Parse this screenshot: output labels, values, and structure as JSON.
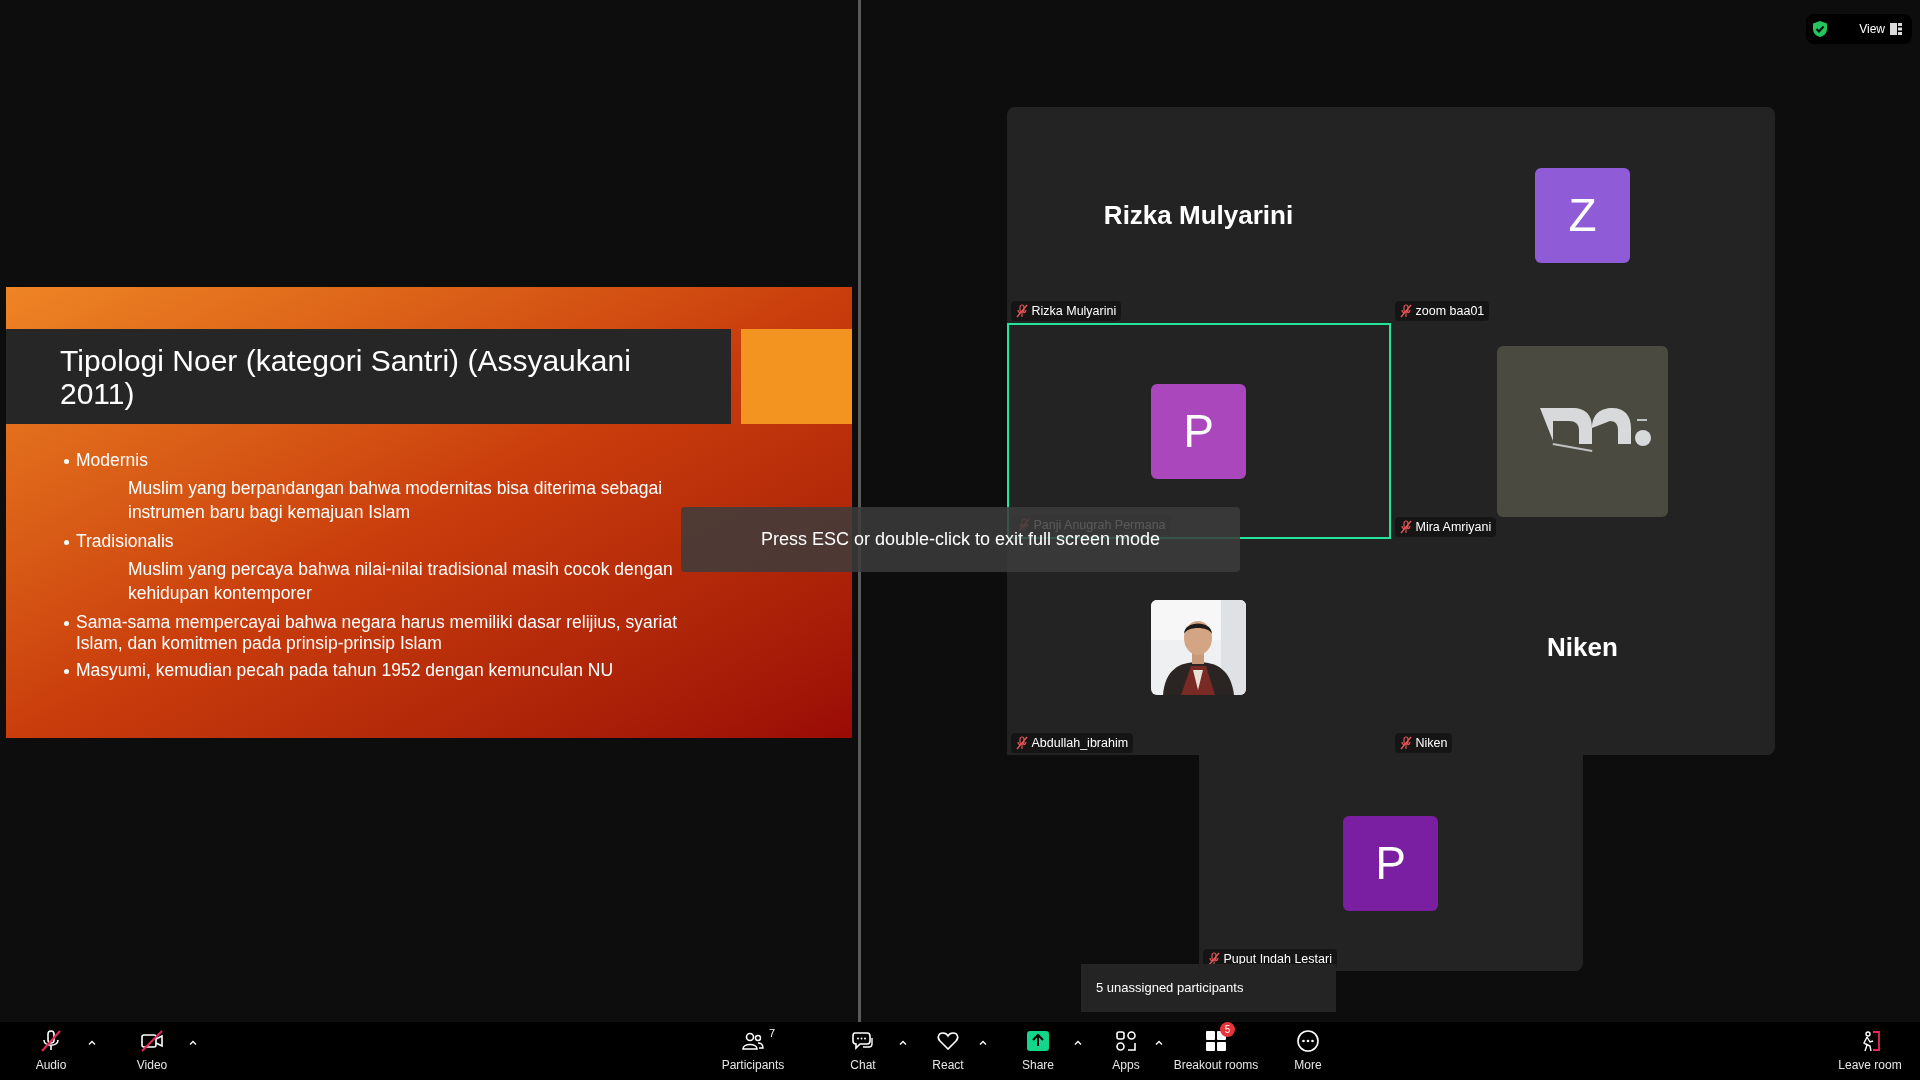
{
  "slide": {
    "title": "Tipologi Noer (kategori Santri) (Assyaukani 2011)",
    "bullets": [
      {
        "text": "Modernis",
        "children": [
          {
            "text": "Muslim yang berpandangan bahwa modernitas bisa diterima sebagai instrumen baru bagi kemajuan Islam"
          }
        ]
      },
      {
        "text": "Tradisionalis",
        "children": [
          {
            "text": "Muslim yang percaya bahwa nilai-nilai tradisional masih cocok dengan kehidupan kontemporer"
          }
        ]
      },
      {
        "text": "Sama-sama mempercayai bahwa negara harus memiliki dasar relijius, syariat Islam, dan komitmen pada prinsip-prinsip Islam"
      },
      {
        "text": "Masyumi, kemudian pecah pada tahun 1952 dengan kemunculan NU"
      }
    ]
  },
  "view_button": {
    "label": "View"
  },
  "tiles": [
    {
      "kind": "name",
      "display": "Rizka Mulyarini",
      "name": "Rizka Mulyarini",
      "muted": true,
      "speaking": false
    },
    {
      "kind": "avatar",
      "initial": "Z",
      "color": "#8f5bd6",
      "name": "zoom baa01",
      "muted": true,
      "speaking": false
    },
    {
      "kind": "avatar",
      "initial": "P",
      "color": "#ab47bc",
      "name": "Panji Anugrah Permana",
      "muted": true,
      "speaking": true
    },
    {
      "kind": "logo",
      "name": "Mira Amriyani",
      "muted": true,
      "speaking": false
    },
    {
      "name": "Abdullah_ibrahim",
      "muted": true,
      "speaking": false
    },
    {
      "kind": "name",
      "display": "Niken",
      "name": "Niken",
      "muted": true,
      "speaking": false
    },
    {
      "kind": "avatar",
      "initial": "P",
      "color": "#7b1fa2",
      "name": "Puput Indah Lestari",
      "muted": true,
      "speaking": false
    }
  ],
  "notice": "Press ESC or double-click to exit full screen mode",
  "tooltip": "5 unassigned participants",
  "toolbar": [
    {
      "kind": "audio",
      "label": "Audio",
      "off": true,
      "menu": true
    },
    {
      "kind": "video",
      "label": "Video",
      "off": true,
      "menu": true
    },
    {
      "kind": "participants",
      "label": "Participants",
      "count": "7",
      "menu": false
    },
    {
      "kind": "chat",
      "label": "Chat",
      "menu": true
    },
    {
      "kind": "react",
      "label": "React",
      "menu": true
    },
    {
      "kind": "share",
      "label": "Share",
      "menu": true
    },
    {
      "kind": "apps",
      "label": "Apps",
      "menu": true
    },
    {
      "kind": "breakout",
      "label": "Breakout rooms",
      "badge": "5",
      "menu": false
    },
    {
      "kind": "more",
      "label": "More",
      "menu": false
    },
    {
      "kind": "leave",
      "label": "Leave room",
      "menu": false
    }
  ]
}
